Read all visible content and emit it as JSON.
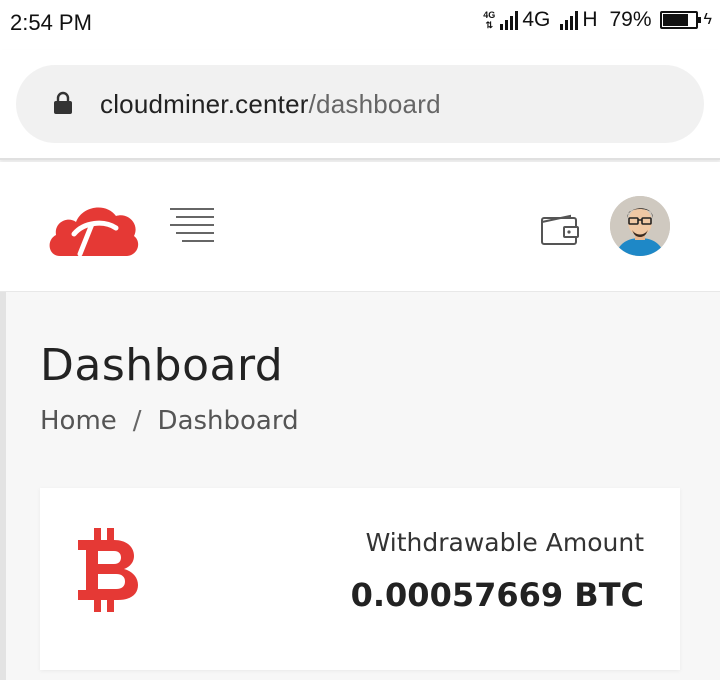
{
  "status_bar": {
    "time": "2:54 PM",
    "network_small": "4G",
    "network_label": "4G",
    "network_label_2": "H",
    "battery_percent": "79%",
    "battery_level": 0.79
  },
  "browser": {
    "url_domain": "cloudminer.center",
    "url_path": "/dashboard"
  },
  "header": {
    "logo_icon": "cloud-pickaxe-logo",
    "menu_icon": "hamburger-menu-icon",
    "wallet_icon": "wallet-icon",
    "avatar_icon": "user-avatar"
  },
  "page": {
    "title": "Dashboard",
    "breadcrumb": {
      "home": "Home",
      "separator": "/",
      "current": "Dashboard"
    }
  },
  "card": {
    "icon": "bitcoin-icon",
    "label": "Withdrawable Amount",
    "value": "0.00057669 BTC"
  },
  "colors": {
    "brand_red": "#e53935",
    "text_dark": "#222222",
    "background": "#f7f7f7"
  }
}
